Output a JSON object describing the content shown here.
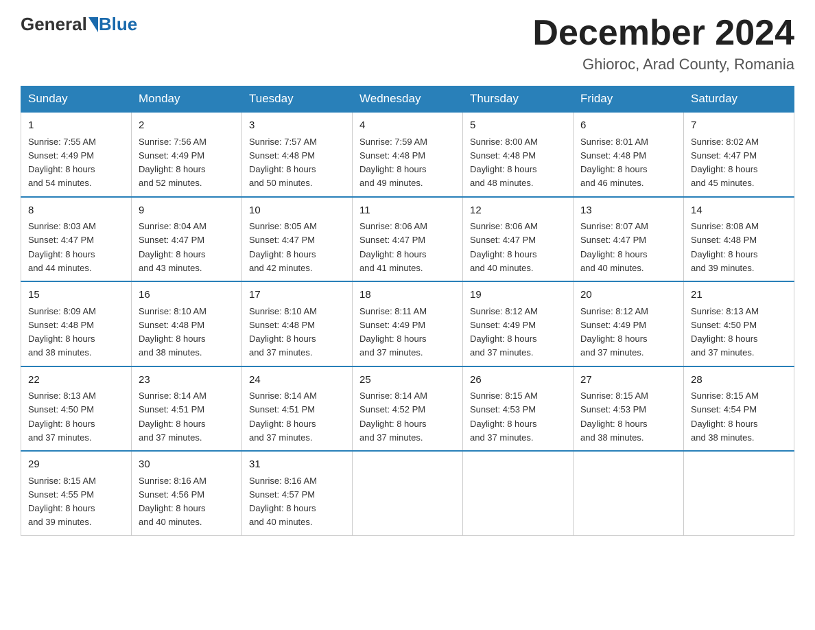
{
  "header": {
    "logo_general": "General",
    "logo_blue": "Blue",
    "month_title": "December 2024",
    "location": "Ghioroc, Arad County, Romania"
  },
  "days_of_week": [
    "Sunday",
    "Monday",
    "Tuesday",
    "Wednesday",
    "Thursday",
    "Friday",
    "Saturday"
  ],
  "weeks": [
    [
      {
        "day": "1",
        "sunrise": "7:55 AM",
        "sunset": "4:49 PM",
        "daylight": "8 hours and 54 minutes."
      },
      {
        "day": "2",
        "sunrise": "7:56 AM",
        "sunset": "4:49 PM",
        "daylight": "8 hours and 52 minutes."
      },
      {
        "day": "3",
        "sunrise": "7:57 AM",
        "sunset": "4:48 PM",
        "daylight": "8 hours and 50 minutes."
      },
      {
        "day": "4",
        "sunrise": "7:59 AM",
        "sunset": "4:48 PM",
        "daylight": "8 hours and 49 minutes."
      },
      {
        "day": "5",
        "sunrise": "8:00 AM",
        "sunset": "4:48 PM",
        "daylight": "8 hours and 48 minutes."
      },
      {
        "day": "6",
        "sunrise": "8:01 AM",
        "sunset": "4:48 PM",
        "daylight": "8 hours and 46 minutes."
      },
      {
        "day": "7",
        "sunrise": "8:02 AM",
        "sunset": "4:47 PM",
        "daylight": "8 hours and 45 minutes."
      }
    ],
    [
      {
        "day": "8",
        "sunrise": "8:03 AM",
        "sunset": "4:47 PM",
        "daylight": "8 hours and 44 minutes."
      },
      {
        "day": "9",
        "sunrise": "8:04 AM",
        "sunset": "4:47 PM",
        "daylight": "8 hours and 43 minutes."
      },
      {
        "day": "10",
        "sunrise": "8:05 AM",
        "sunset": "4:47 PM",
        "daylight": "8 hours and 42 minutes."
      },
      {
        "day": "11",
        "sunrise": "8:06 AM",
        "sunset": "4:47 PM",
        "daylight": "8 hours and 41 minutes."
      },
      {
        "day": "12",
        "sunrise": "8:06 AM",
        "sunset": "4:47 PM",
        "daylight": "8 hours and 40 minutes."
      },
      {
        "day": "13",
        "sunrise": "8:07 AM",
        "sunset": "4:47 PM",
        "daylight": "8 hours and 40 minutes."
      },
      {
        "day": "14",
        "sunrise": "8:08 AM",
        "sunset": "4:48 PM",
        "daylight": "8 hours and 39 minutes."
      }
    ],
    [
      {
        "day": "15",
        "sunrise": "8:09 AM",
        "sunset": "4:48 PM",
        "daylight": "8 hours and 38 minutes."
      },
      {
        "day": "16",
        "sunrise": "8:10 AM",
        "sunset": "4:48 PM",
        "daylight": "8 hours and 38 minutes."
      },
      {
        "day": "17",
        "sunrise": "8:10 AM",
        "sunset": "4:48 PM",
        "daylight": "8 hours and 37 minutes."
      },
      {
        "day": "18",
        "sunrise": "8:11 AM",
        "sunset": "4:49 PM",
        "daylight": "8 hours and 37 minutes."
      },
      {
        "day": "19",
        "sunrise": "8:12 AM",
        "sunset": "4:49 PM",
        "daylight": "8 hours and 37 minutes."
      },
      {
        "day": "20",
        "sunrise": "8:12 AM",
        "sunset": "4:49 PM",
        "daylight": "8 hours and 37 minutes."
      },
      {
        "day": "21",
        "sunrise": "8:13 AM",
        "sunset": "4:50 PM",
        "daylight": "8 hours and 37 minutes."
      }
    ],
    [
      {
        "day": "22",
        "sunrise": "8:13 AM",
        "sunset": "4:50 PM",
        "daylight": "8 hours and 37 minutes."
      },
      {
        "day": "23",
        "sunrise": "8:14 AM",
        "sunset": "4:51 PM",
        "daylight": "8 hours and 37 minutes."
      },
      {
        "day": "24",
        "sunrise": "8:14 AM",
        "sunset": "4:51 PM",
        "daylight": "8 hours and 37 minutes."
      },
      {
        "day": "25",
        "sunrise": "8:14 AM",
        "sunset": "4:52 PM",
        "daylight": "8 hours and 37 minutes."
      },
      {
        "day": "26",
        "sunrise": "8:15 AM",
        "sunset": "4:53 PM",
        "daylight": "8 hours and 37 minutes."
      },
      {
        "day": "27",
        "sunrise": "8:15 AM",
        "sunset": "4:53 PM",
        "daylight": "8 hours and 38 minutes."
      },
      {
        "day": "28",
        "sunrise": "8:15 AM",
        "sunset": "4:54 PM",
        "daylight": "8 hours and 38 minutes."
      }
    ],
    [
      {
        "day": "29",
        "sunrise": "8:15 AM",
        "sunset": "4:55 PM",
        "daylight": "8 hours and 39 minutes."
      },
      {
        "day": "30",
        "sunrise": "8:16 AM",
        "sunset": "4:56 PM",
        "daylight": "8 hours and 40 minutes."
      },
      {
        "day": "31",
        "sunrise": "8:16 AM",
        "sunset": "4:57 PM",
        "daylight": "8 hours and 40 minutes."
      },
      null,
      null,
      null,
      null
    ]
  ],
  "labels": {
    "sunrise": "Sunrise:",
    "sunset": "Sunset:",
    "daylight": "Daylight:"
  }
}
